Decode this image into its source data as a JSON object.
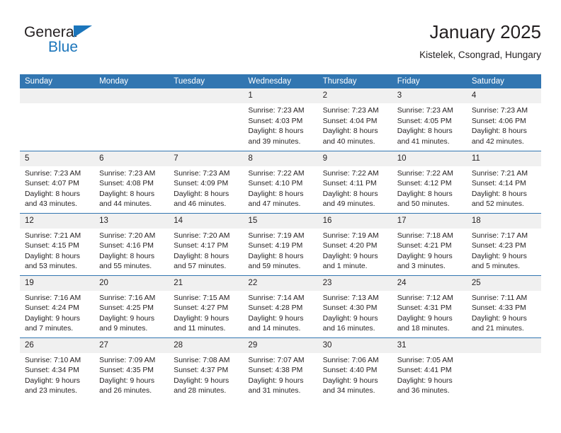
{
  "brand": {
    "name_part1": "General",
    "name_part2": "Blue",
    "triangle_icon": "triangle-icon",
    "accent_color": "#1b75bb"
  },
  "header": {
    "title": "January 2025",
    "location": "Kistelek, Csongrad, Hungary"
  },
  "theme": {
    "header_blue": "#3276b1",
    "daynum_band": "#f0f0f0",
    "text": "#231f20"
  },
  "weekdays": [
    "Sunday",
    "Monday",
    "Tuesday",
    "Wednesday",
    "Thursday",
    "Friday",
    "Saturday"
  ],
  "weeks": [
    [
      {
        "day": "",
        "empty": true,
        "sunrise": "",
        "sunset": "",
        "daylight1": "",
        "daylight2": ""
      },
      {
        "day": "",
        "empty": true,
        "sunrise": "",
        "sunset": "",
        "daylight1": "",
        "daylight2": ""
      },
      {
        "day": "",
        "empty": true,
        "sunrise": "",
        "sunset": "",
        "daylight1": "",
        "daylight2": ""
      },
      {
        "day": "1",
        "sunrise": "Sunrise: 7:23 AM",
        "sunset": "Sunset: 4:03 PM",
        "daylight1": "Daylight: 8 hours",
        "daylight2": "and 39 minutes."
      },
      {
        "day": "2",
        "sunrise": "Sunrise: 7:23 AM",
        "sunset": "Sunset: 4:04 PM",
        "daylight1": "Daylight: 8 hours",
        "daylight2": "and 40 minutes."
      },
      {
        "day": "3",
        "sunrise": "Sunrise: 7:23 AM",
        "sunset": "Sunset: 4:05 PM",
        "daylight1": "Daylight: 8 hours",
        "daylight2": "and 41 minutes."
      },
      {
        "day": "4",
        "sunrise": "Sunrise: 7:23 AM",
        "sunset": "Sunset: 4:06 PM",
        "daylight1": "Daylight: 8 hours",
        "daylight2": "and 42 minutes."
      }
    ],
    [
      {
        "day": "5",
        "sunrise": "Sunrise: 7:23 AM",
        "sunset": "Sunset: 4:07 PM",
        "daylight1": "Daylight: 8 hours",
        "daylight2": "and 43 minutes."
      },
      {
        "day": "6",
        "sunrise": "Sunrise: 7:23 AM",
        "sunset": "Sunset: 4:08 PM",
        "daylight1": "Daylight: 8 hours",
        "daylight2": "and 44 minutes."
      },
      {
        "day": "7",
        "sunrise": "Sunrise: 7:23 AM",
        "sunset": "Sunset: 4:09 PM",
        "daylight1": "Daylight: 8 hours",
        "daylight2": "and 46 minutes."
      },
      {
        "day": "8",
        "sunrise": "Sunrise: 7:22 AM",
        "sunset": "Sunset: 4:10 PM",
        "daylight1": "Daylight: 8 hours",
        "daylight2": "and 47 minutes."
      },
      {
        "day": "9",
        "sunrise": "Sunrise: 7:22 AM",
        "sunset": "Sunset: 4:11 PM",
        "daylight1": "Daylight: 8 hours",
        "daylight2": "and 49 minutes."
      },
      {
        "day": "10",
        "sunrise": "Sunrise: 7:22 AM",
        "sunset": "Sunset: 4:12 PM",
        "daylight1": "Daylight: 8 hours",
        "daylight2": "and 50 minutes."
      },
      {
        "day": "11",
        "sunrise": "Sunrise: 7:21 AM",
        "sunset": "Sunset: 4:14 PM",
        "daylight1": "Daylight: 8 hours",
        "daylight2": "and 52 minutes."
      }
    ],
    [
      {
        "day": "12",
        "sunrise": "Sunrise: 7:21 AM",
        "sunset": "Sunset: 4:15 PM",
        "daylight1": "Daylight: 8 hours",
        "daylight2": "and 53 minutes."
      },
      {
        "day": "13",
        "sunrise": "Sunrise: 7:20 AM",
        "sunset": "Sunset: 4:16 PM",
        "daylight1": "Daylight: 8 hours",
        "daylight2": "and 55 minutes."
      },
      {
        "day": "14",
        "sunrise": "Sunrise: 7:20 AM",
        "sunset": "Sunset: 4:17 PM",
        "daylight1": "Daylight: 8 hours",
        "daylight2": "and 57 minutes."
      },
      {
        "day": "15",
        "sunrise": "Sunrise: 7:19 AM",
        "sunset": "Sunset: 4:19 PM",
        "daylight1": "Daylight: 8 hours",
        "daylight2": "and 59 minutes."
      },
      {
        "day": "16",
        "sunrise": "Sunrise: 7:19 AM",
        "sunset": "Sunset: 4:20 PM",
        "daylight1": "Daylight: 9 hours",
        "daylight2": "and 1 minute."
      },
      {
        "day": "17",
        "sunrise": "Sunrise: 7:18 AM",
        "sunset": "Sunset: 4:21 PM",
        "daylight1": "Daylight: 9 hours",
        "daylight2": "and 3 minutes."
      },
      {
        "day": "18",
        "sunrise": "Sunrise: 7:17 AM",
        "sunset": "Sunset: 4:23 PM",
        "daylight1": "Daylight: 9 hours",
        "daylight2": "and 5 minutes."
      }
    ],
    [
      {
        "day": "19",
        "sunrise": "Sunrise: 7:16 AM",
        "sunset": "Sunset: 4:24 PM",
        "daylight1": "Daylight: 9 hours",
        "daylight2": "and 7 minutes."
      },
      {
        "day": "20",
        "sunrise": "Sunrise: 7:16 AM",
        "sunset": "Sunset: 4:25 PM",
        "daylight1": "Daylight: 9 hours",
        "daylight2": "and 9 minutes."
      },
      {
        "day": "21",
        "sunrise": "Sunrise: 7:15 AM",
        "sunset": "Sunset: 4:27 PM",
        "daylight1": "Daylight: 9 hours",
        "daylight2": "and 11 minutes."
      },
      {
        "day": "22",
        "sunrise": "Sunrise: 7:14 AM",
        "sunset": "Sunset: 4:28 PM",
        "daylight1": "Daylight: 9 hours",
        "daylight2": "and 14 minutes."
      },
      {
        "day": "23",
        "sunrise": "Sunrise: 7:13 AM",
        "sunset": "Sunset: 4:30 PM",
        "daylight1": "Daylight: 9 hours",
        "daylight2": "and 16 minutes."
      },
      {
        "day": "24",
        "sunrise": "Sunrise: 7:12 AM",
        "sunset": "Sunset: 4:31 PM",
        "daylight1": "Daylight: 9 hours",
        "daylight2": "and 18 minutes."
      },
      {
        "day": "25",
        "sunrise": "Sunrise: 7:11 AM",
        "sunset": "Sunset: 4:33 PM",
        "daylight1": "Daylight: 9 hours",
        "daylight2": "and 21 minutes."
      }
    ],
    [
      {
        "day": "26",
        "sunrise": "Sunrise: 7:10 AM",
        "sunset": "Sunset: 4:34 PM",
        "daylight1": "Daylight: 9 hours",
        "daylight2": "and 23 minutes."
      },
      {
        "day": "27",
        "sunrise": "Sunrise: 7:09 AM",
        "sunset": "Sunset: 4:35 PM",
        "daylight1": "Daylight: 9 hours",
        "daylight2": "and 26 minutes."
      },
      {
        "day": "28",
        "sunrise": "Sunrise: 7:08 AM",
        "sunset": "Sunset: 4:37 PM",
        "daylight1": "Daylight: 9 hours",
        "daylight2": "and 28 minutes."
      },
      {
        "day": "29",
        "sunrise": "Sunrise: 7:07 AM",
        "sunset": "Sunset: 4:38 PM",
        "daylight1": "Daylight: 9 hours",
        "daylight2": "and 31 minutes."
      },
      {
        "day": "30",
        "sunrise": "Sunrise: 7:06 AM",
        "sunset": "Sunset: 4:40 PM",
        "daylight1": "Daylight: 9 hours",
        "daylight2": "and 34 minutes."
      },
      {
        "day": "31",
        "sunrise": "Sunrise: 7:05 AM",
        "sunset": "Sunset: 4:41 PM",
        "daylight1": "Daylight: 9 hours",
        "daylight2": "and 36 minutes."
      },
      {
        "day": "",
        "empty": true,
        "sunrise": "",
        "sunset": "",
        "daylight1": "",
        "daylight2": ""
      }
    ]
  ]
}
